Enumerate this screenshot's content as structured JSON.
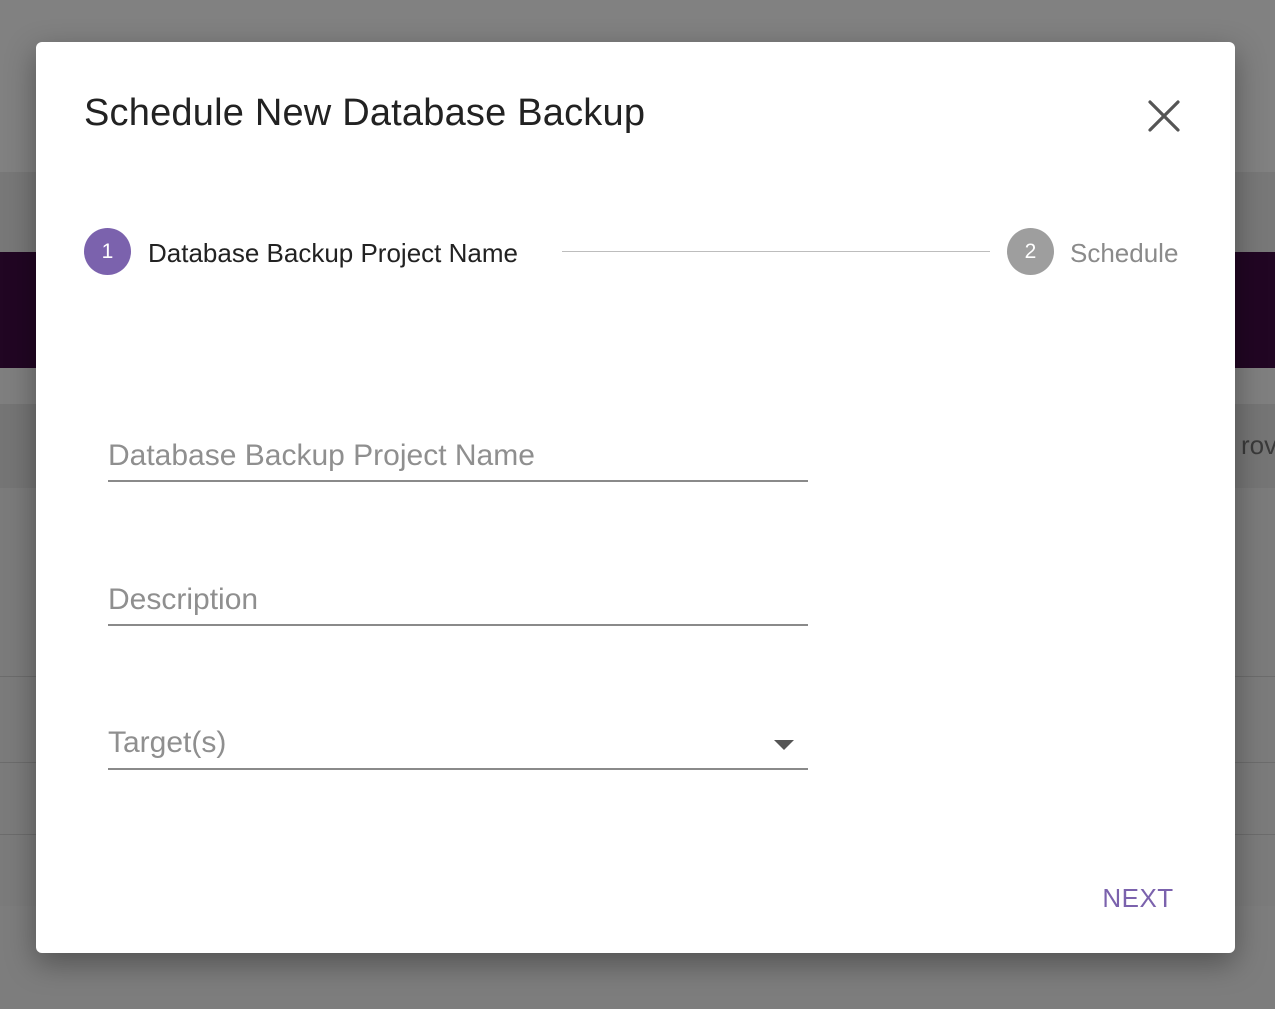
{
  "background": {
    "partial_text": "rov"
  },
  "dialog": {
    "title": "Schedule New Database Backup",
    "close_icon": "close-icon"
  },
  "stepper": {
    "steps": [
      {
        "number": "1",
        "label": "Database Backup Project Name",
        "state": "active",
        "color": "#7b62ad"
      },
      {
        "number": "2",
        "label": "Schedule",
        "state": "inactive",
        "color": "#9e9e9e"
      }
    ]
  },
  "form": {
    "project_name": {
      "placeholder": "Database Backup Project Name",
      "value": ""
    },
    "description": {
      "placeholder": "Description",
      "value": ""
    },
    "targets": {
      "placeholder": "Target(s)",
      "value": ""
    }
  },
  "actions": {
    "next_label": "NEXT"
  },
  "colors": {
    "accent": "#7b62ad",
    "header_band": "#210623"
  }
}
